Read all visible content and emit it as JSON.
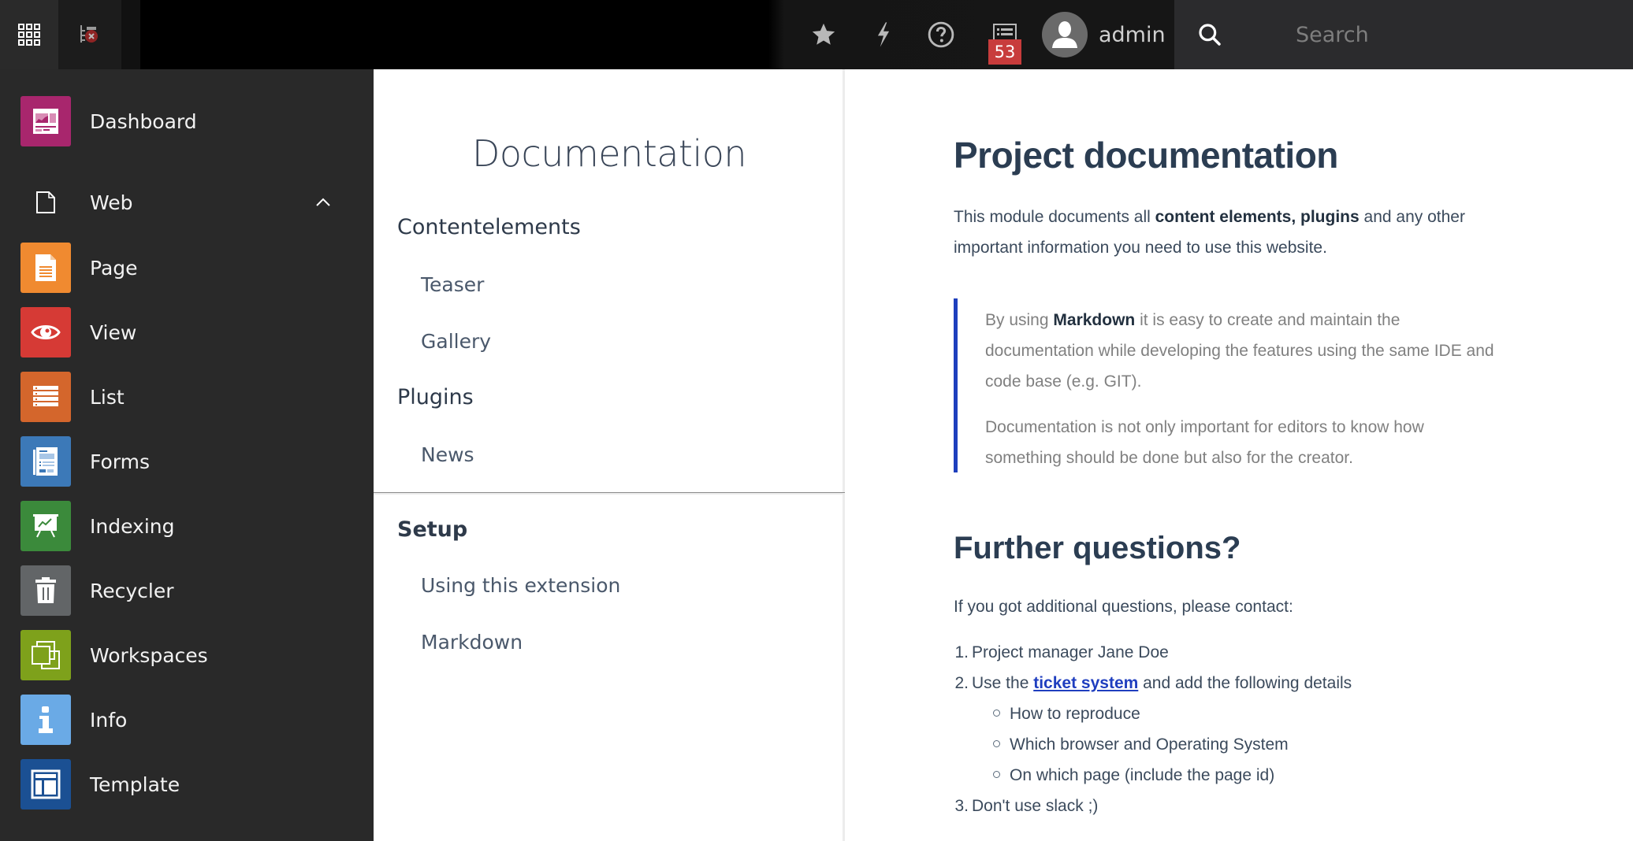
{
  "topbar": {
    "module_menu_icon": "grid-icon",
    "clear_cache_icon": "clear-cache-icon",
    "toolbar": [
      {
        "name": "bookmarks",
        "icon": "star-icon"
      },
      {
        "name": "clear-cache",
        "icon": "bolt-icon"
      },
      {
        "name": "help",
        "icon": "help-circle-icon"
      },
      {
        "name": "system-information",
        "icon": "list-icon",
        "badge": "53"
      }
    ],
    "user": {
      "name": "admin",
      "icon": "user-avatar-icon"
    },
    "search": {
      "placeholder": "Search",
      "value": ""
    }
  },
  "sidebar": {
    "items": [
      {
        "label": "Dashboard",
        "icon": "dashboard-icon",
        "color": "#a8266d"
      },
      {
        "label": "Web",
        "icon": "page-outline-icon",
        "group": true,
        "expanded": true
      },
      {
        "label": "Page",
        "icon": "page-icon",
        "color": "#f08a30"
      },
      {
        "label": "View",
        "icon": "eye-icon",
        "color": "#d63a35"
      },
      {
        "label": "List",
        "icon": "list-icon",
        "color": "#d4662c"
      },
      {
        "label": "Forms",
        "icon": "forms-icon",
        "color": "#3c79b8"
      },
      {
        "label": "Indexing",
        "icon": "indexing-chart-icon",
        "color": "#3b8a3b"
      },
      {
        "label": "Recycler",
        "icon": "trash-icon",
        "color": "#626567"
      },
      {
        "label": "Workspaces",
        "icon": "workspaces-icon",
        "color": "#7ea11b"
      },
      {
        "label": "Info",
        "icon": "info-icon",
        "color": "#6aaae6"
      },
      {
        "label": "Template",
        "icon": "template-icon",
        "color": "#1b5093"
      }
    ]
  },
  "docnav": {
    "title": "Documentation",
    "sections": [
      {
        "label": "Contentelements",
        "items": [
          "Teaser",
          "Gallery"
        ]
      },
      {
        "label": "Plugins",
        "items": [
          "News"
        ]
      },
      {
        "label": "Setup",
        "items": [
          "Using this extension",
          "Markdown"
        ]
      }
    ]
  },
  "content": {
    "title": "Project documentation",
    "intro": {
      "pre": "This module documents all ",
      "bold1": "content elements",
      "sep": ", ",
      "bold2": "plugins",
      "post1": " and any other",
      "line2": "important information you need to use this website."
    },
    "blockquote": {
      "p1_pre": "By using ",
      "p1_bold": "Markdown",
      "p1_post": " it is easy to create and maintain the",
      "p1_line2": "documentation while developing the features using the same IDE and",
      "p1_line3": "code base (e.g. GIT).",
      "p2_line1": "Documentation is not only important for editors to know how",
      "p2_line2": "something should be done but also for the creator."
    },
    "subtitle": "Further questions?",
    "contact_intro": "If you got additional questions, please contact:",
    "list": [
      {
        "num": "1.",
        "text": "Project manager Jane Doe"
      },
      {
        "num": "2.",
        "pre": "Use the ",
        "link": "ticket system",
        "post": " and add the following details",
        "subitems": [
          "How to reproduce",
          "Which browser and Operating System",
          "On which page (include the page id)"
        ]
      },
      {
        "num": "3.",
        "text": "Don't use slack ;)"
      }
    ]
  },
  "colors": {
    "sidebar_bg": "#292929",
    "blockquote_border": "#1e3fbd",
    "link": "#1f3ebf",
    "badge": "#c83c3c",
    "heading": "#2b3d52"
  }
}
